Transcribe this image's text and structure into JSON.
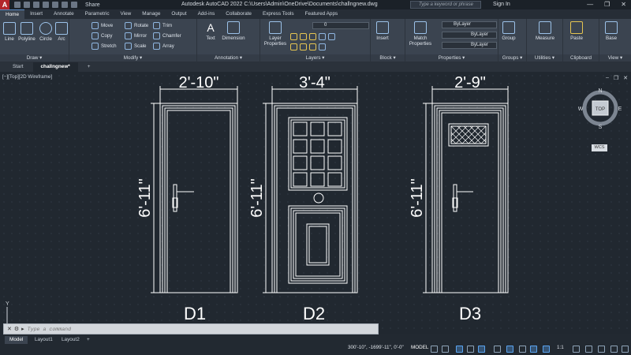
{
  "title_bar": {
    "app_logo": "A",
    "share_label": "Share",
    "title": "Autodesk AutoCAD 2022   C:\\Users\\Admin\\OneDrive\\Documents\\challngnew.dwg",
    "search_placeholder": "Type a keyword or phrase",
    "signin": "Sign In"
  },
  "ribbon_tabs": [
    "Home",
    "Insert",
    "Annotate",
    "Parametric",
    "View",
    "Manage",
    "Output",
    "Add-ins",
    "Collaborate",
    "Express Tools",
    "Featured Apps"
  ],
  "ribbon": {
    "draw": {
      "label": "Draw ▾",
      "line": "Line",
      "polyline": "Polyline",
      "circle": "Circle",
      "arc": "Arc"
    },
    "modify": {
      "label": "Modify ▾",
      "move": "Move",
      "rotate": "Rotate",
      "trim": "Trim",
      "copy": "Copy",
      "mirror": "Mirror",
      "chamfer": "Chamfer",
      "stretch": "Stretch",
      "scale": "Scale",
      "array": "Array"
    },
    "annotation": {
      "label": "Annotation ▾",
      "text": "Text",
      "dimension": "Dimension"
    },
    "layers": {
      "label": "Layers ▾",
      "layer_properties": "Layer\nProperties",
      "layer_value": "0"
    },
    "block": {
      "label": "Block ▾",
      "insert": "Insert"
    },
    "properties": {
      "label": "Properties ▾",
      "match": "Match\nProperties",
      "color": "ByLayer",
      "linetype": "ByLayer",
      "lineweight": "ByLayer"
    },
    "groups": {
      "label": "Groups ▾",
      "group": "Group"
    },
    "utilities": {
      "label": "Utilities ▾",
      "measure": "Measure"
    },
    "clipboard": {
      "label": "Clipboard",
      "paste": "Paste"
    },
    "view": {
      "label": "View ▾",
      "base": "Base"
    }
  },
  "file_tabs": [
    "Start",
    "challngnew*"
  ],
  "viewport_label": "[−][Top][2D Wireframe]",
  "viewcube": {
    "n": "N",
    "s": "S",
    "e": "E",
    "w": "W",
    "top": "TOP",
    "wcs": "WCS"
  },
  "doors": [
    {
      "label": "D1",
      "width": "2'-10\"",
      "height": "6'-11\""
    },
    {
      "label": "D2",
      "width": "3'-4\"",
      "height": "6'-11\""
    },
    {
      "label": "D3",
      "width": "2'-9\"",
      "height": "6'-11\""
    }
  ],
  "command_placeholder": "Type a command",
  "status": {
    "layout_tabs": [
      "Model",
      "Layout1",
      "Layout2"
    ],
    "coords": "300'-10\", -1699'-11\", 0'-0\"",
    "model": "MODEL",
    "scale": "1:1"
  },
  "ucs": {
    "y": "Y"
  }
}
